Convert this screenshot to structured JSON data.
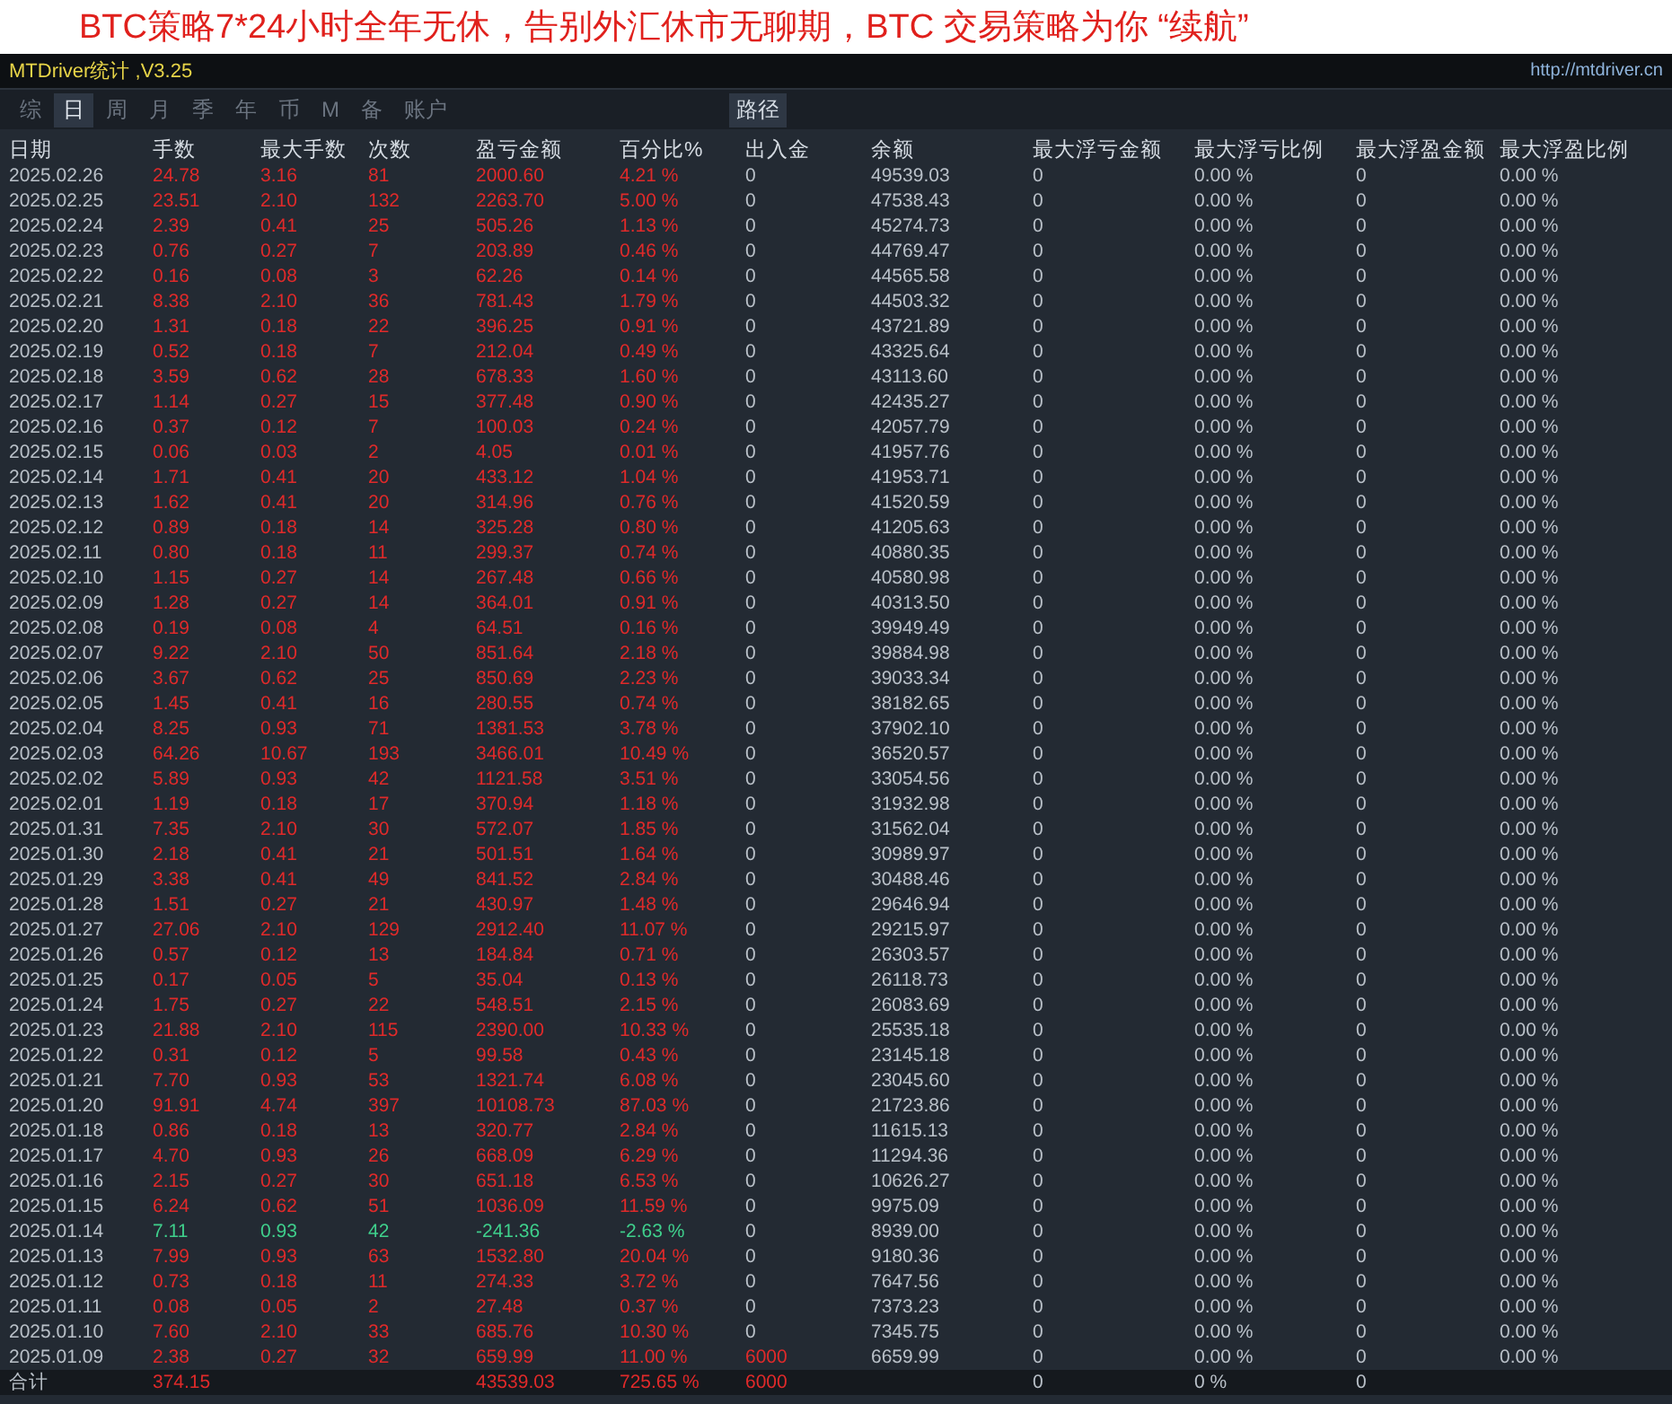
{
  "headline": "BTC策略7*24小时全年无休，告别外汇休市无聊期，BTC 交易策略为你 “续航”",
  "window": {
    "title": "MTDriver统计 ,V3.25",
    "url": "http://mtdriver.cn"
  },
  "tabs": [
    {
      "label": "综",
      "selected": false
    },
    {
      "label": "日",
      "selected": true
    },
    {
      "label": "周",
      "selected": false
    },
    {
      "label": "月",
      "selected": false
    },
    {
      "label": "季",
      "selected": false
    },
    {
      "label": "年",
      "selected": false
    },
    {
      "label": "币",
      "selected": false
    },
    {
      "label": "M",
      "selected": false
    },
    {
      "label": "备",
      "selected": false
    },
    {
      "label": "账户",
      "selected": false
    }
  ],
  "path_button": "路径",
  "columns": [
    "日期",
    "手数",
    "最大手数",
    "次数",
    "盈亏金额",
    "百分比%",
    "出入金",
    "余额",
    "最大浮亏金额",
    "最大浮亏比例",
    "最大浮盈金额",
    "最大浮盈比例"
  ],
  "rows": [
    {
      "cells": [
        "2025.02.26",
        "24.78",
        "3.16",
        "81",
        "2000.60",
        "4.21 %",
        "0",
        "49539.03",
        "0",
        "0.00 %",
        "0",
        "0.00 %"
      ],
      "loss": false,
      "deposit": false
    },
    {
      "cells": [
        "2025.02.25",
        "23.51",
        "2.10",
        "132",
        "2263.70",
        "5.00 %",
        "0",
        "47538.43",
        "0",
        "0.00 %",
        "0",
        "0.00 %"
      ],
      "loss": false,
      "deposit": false
    },
    {
      "cells": [
        "2025.02.24",
        "2.39",
        "0.41",
        "25",
        "505.26",
        "1.13 %",
        "0",
        "45274.73",
        "0",
        "0.00 %",
        "0",
        "0.00 %"
      ],
      "loss": false,
      "deposit": false
    },
    {
      "cells": [
        "2025.02.23",
        "0.76",
        "0.27",
        "7",
        "203.89",
        "0.46 %",
        "0",
        "44769.47",
        "0",
        "0.00 %",
        "0",
        "0.00 %"
      ],
      "loss": false,
      "deposit": false
    },
    {
      "cells": [
        "2025.02.22",
        "0.16",
        "0.08",
        "3",
        "62.26",
        "0.14 %",
        "0",
        "44565.58",
        "0",
        "0.00 %",
        "0",
        "0.00 %"
      ],
      "loss": false,
      "deposit": false
    },
    {
      "cells": [
        "2025.02.21",
        "8.38",
        "2.10",
        "36",
        "781.43",
        "1.79 %",
        "0",
        "44503.32",
        "0",
        "0.00 %",
        "0",
        "0.00 %"
      ],
      "loss": false,
      "deposit": false
    },
    {
      "cells": [
        "2025.02.20",
        "1.31",
        "0.18",
        "22",
        "396.25",
        "0.91 %",
        "0",
        "43721.89",
        "0",
        "0.00 %",
        "0",
        "0.00 %"
      ],
      "loss": false,
      "deposit": false
    },
    {
      "cells": [
        "2025.02.19",
        "0.52",
        "0.18",
        "7",
        "212.04",
        "0.49 %",
        "0",
        "43325.64",
        "0",
        "0.00 %",
        "0",
        "0.00 %"
      ],
      "loss": false,
      "deposit": false
    },
    {
      "cells": [
        "2025.02.18",
        "3.59",
        "0.62",
        "28",
        "678.33",
        "1.60 %",
        "0",
        "43113.60",
        "0",
        "0.00 %",
        "0",
        "0.00 %"
      ],
      "loss": false,
      "deposit": false
    },
    {
      "cells": [
        "2025.02.17",
        "1.14",
        "0.27",
        "15",
        "377.48",
        "0.90 %",
        "0",
        "42435.27",
        "0",
        "0.00 %",
        "0",
        "0.00 %"
      ],
      "loss": false,
      "deposit": false
    },
    {
      "cells": [
        "2025.02.16",
        "0.37",
        "0.12",
        "7",
        "100.03",
        "0.24 %",
        "0",
        "42057.79",
        "0",
        "0.00 %",
        "0",
        "0.00 %"
      ],
      "loss": false,
      "deposit": false
    },
    {
      "cells": [
        "2025.02.15",
        "0.06",
        "0.03",
        "2",
        "4.05",
        "0.01 %",
        "0",
        "41957.76",
        "0",
        "0.00 %",
        "0",
        "0.00 %"
      ],
      "loss": false,
      "deposit": false
    },
    {
      "cells": [
        "2025.02.14",
        "1.71",
        "0.41",
        "20",
        "433.12",
        "1.04 %",
        "0",
        "41953.71",
        "0",
        "0.00 %",
        "0",
        "0.00 %"
      ],
      "loss": false,
      "deposit": false
    },
    {
      "cells": [
        "2025.02.13",
        "1.62",
        "0.41",
        "20",
        "314.96",
        "0.76 %",
        "0",
        "41520.59",
        "0",
        "0.00 %",
        "0",
        "0.00 %"
      ],
      "loss": false,
      "deposit": false
    },
    {
      "cells": [
        "2025.02.12",
        "0.89",
        "0.18",
        "14",
        "325.28",
        "0.80 %",
        "0",
        "41205.63",
        "0",
        "0.00 %",
        "0",
        "0.00 %"
      ],
      "loss": false,
      "deposit": false
    },
    {
      "cells": [
        "2025.02.11",
        "0.80",
        "0.18",
        "11",
        "299.37",
        "0.74 %",
        "0",
        "40880.35",
        "0",
        "0.00 %",
        "0",
        "0.00 %"
      ],
      "loss": false,
      "deposit": false
    },
    {
      "cells": [
        "2025.02.10",
        "1.15",
        "0.27",
        "14",
        "267.48",
        "0.66 %",
        "0",
        "40580.98",
        "0",
        "0.00 %",
        "0",
        "0.00 %"
      ],
      "loss": false,
      "deposit": false
    },
    {
      "cells": [
        "2025.02.09",
        "1.28",
        "0.27",
        "14",
        "364.01",
        "0.91 %",
        "0",
        "40313.50",
        "0",
        "0.00 %",
        "0",
        "0.00 %"
      ],
      "loss": false,
      "deposit": false
    },
    {
      "cells": [
        "2025.02.08",
        "0.19",
        "0.08",
        "4",
        "64.51",
        "0.16 %",
        "0",
        "39949.49",
        "0",
        "0.00 %",
        "0",
        "0.00 %"
      ],
      "loss": false,
      "deposit": false
    },
    {
      "cells": [
        "2025.02.07",
        "9.22",
        "2.10",
        "50",
        "851.64",
        "2.18 %",
        "0",
        "39884.98",
        "0",
        "0.00 %",
        "0",
        "0.00 %"
      ],
      "loss": false,
      "deposit": false
    },
    {
      "cells": [
        "2025.02.06",
        "3.67",
        "0.62",
        "25",
        "850.69",
        "2.23 %",
        "0",
        "39033.34",
        "0",
        "0.00 %",
        "0",
        "0.00 %"
      ],
      "loss": false,
      "deposit": false
    },
    {
      "cells": [
        "2025.02.05",
        "1.45",
        "0.41",
        "16",
        "280.55",
        "0.74 %",
        "0",
        "38182.65",
        "0",
        "0.00 %",
        "0",
        "0.00 %"
      ],
      "loss": false,
      "deposit": false
    },
    {
      "cells": [
        "2025.02.04",
        "8.25",
        "0.93",
        "71",
        "1381.53",
        "3.78 %",
        "0",
        "37902.10",
        "0",
        "0.00 %",
        "0",
        "0.00 %"
      ],
      "loss": false,
      "deposit": false
    },
    {
      "cells": [
        "2025.02.03",
        "64.26",
        "10.67",
        "193",
        "3466.01",
        "10.49 %",
        "0",
        "36520.57",
        "0",
        "0.00 %",
        "0",
        "0.00 %"
      ],
      "loss": false,
      "deposit": false
    },
    {
      "cells": [
        "2025.02.02",
        "5.89",
        "0.93",
        "42",
        "1121.58",
        "3.51 %",
        "0",
        "33054.56",
        "0",
        "0.00 %",
        "0",
        "0.00 %"
      ],
      "loss": false,
      "deposit": false
    },
    {
      "cells": [
        "2025.02.01",
        "1.19",
        "0.18",
        "17",
        "370.94",
        "1.18 %",
        "0",
        "31932.98",
        "0",
        "0.00 %",
        "0",
        "0.00 %"
      ],
      "loss": false,
      "deposit": false
    },
    {
      "cells": [
        "2025.01.31",
        "7.35",
        "2.10",
        "30",
        "572.07",
        "1.85 %",
        "0",
        "31562.04",
        "0",
        "0.00 %",
        "0",
        "0.00 %"
      ],
      "loss": false,
      "deposit": false
    },
    {
      "cells": [
        "2025.01.30",
        "2.18",
        "0.41",
        "21",
        "501.51",
        "1.64 %",
        "0",
        "30989.97",
        "0",
        "0.00 %",
        "0",
        "0.00 %"
      ],
      "loss": false,
      "deposit": false
    },
    {
      "cells": [
        "2025.01.29",
        "3.38",
        "0.41",
        "49",
        "841.52",
        "2.84 %",
        "0",
        "30488.46",
        "0",
        "0.00 %",
        "0",
        "0.00 %"
      ],
      "loss": false,
      "deposit": false
    },
    {
      "cells": [
        "2025.01.28",
        "1.51",
        "0.27",
        "21",
        "430.97",
        "1.48 %",
        "0",
        "29646.94",
        "0",
        "0.00 %",
        "0",
        "0.00 %"
      ],
      "loss": false,
      "deposit": false
    },
    {
      "cells": [
        "2025.01.27",
        "27.06",
        "2.10",
        "129",
        "2912.40",
        "11.07 %",
        "0",
        "29215.97",
        "0",
        "0.00 %",
        "0",
        "0.00 %"
      ],
      "loss": false,
      "deposit": false
    },
    {
      "cells": [
        "2025.01.26",
        "0.57",
        "0.12",
        "13",
        "184.84",
        "0.71 %",
        "0",
        "26303.57",
        "0",
        "0.00 %",
        "0",
        "0.00 %"
      ],
      "loss": false,
      "deposit": false
    },
    {
      "cells": [
        "2025.01.25",
        "0.17",
        "0.05",
        "5",
        "35.04",
        "0.13 %",
        "0",
        "26118.73",
        "0",
        "0.00 %",
        "0",
        "0.00 %"
      ],
      "loss": false,
      "deposit": false
    },
    {
      "cells": [
        "2025.01.24",
        "1.75",
        "0.27",
        "22",
        "548.51",
        "2.15 %",
        "0",
        "26083.69",
        "0",
        "0.00 %",
        "0",
        "0.00 %"
      ],
      "loss": false,
      "deposit": false
    },
    {
      "cells": [
        "2025.01.23",
        "21.88",
        "2.10",
        "115",
        "2390.00",
        "10.33 %",
        "0",
        "25535.18",
        "0",
        "0.00 %",
        "0",
        "0.00 %"
      ],
      "loss": false,
      "deposit": false
    },
    {
      "cells": [
        "2025.01.22",
        "0.31",
        "0.12",
        "5",
        "99.58",
        "0.43 %",
        "0",
        "23145.18",
        "0",
        "0.00 %",
        "0",
        "0.00 %"
      ],
      "loss": false,
      "deposit": false
    },
    {
      "cells": [
        "2025.01.21",
        "7.70",
        "0.93",
        "53",
        "1321.74",
        "6.08 %",
        "0",
        "23045.60",
        "0",
        "0.00 %",
        "0",
        "0.00 %"
      ],
      "loss": false,
      "deposit": false
    },
    {
      "cells": [
        "2025.01.20",
        "91.91",
        "4.74",
        "397",
        "10108.73",
        "87.03 %",
        "0",
        "21723.86",
        "0",
        "0.00 %",
        "0",
        "0.00 %"
      ],
      "loss": false,
      "deposit": false
    },
    {
      "cells": [
        "2025.01.18",
        "0.86",
        "0.18",
        "13",
        "320.77",
        "2.84 %",
        "0",
        "11615.13",
        "0",
        "0.00 %",
        "0",
        "0.00 %"
      ],
      "loss": false,
      "deposit": false
    },
    {
      "cells": [
        "2025.01.17",
        "4.70",
        "0.93",
        "26",
        "668.09",
        "6.29 %",
        "0",
        "11294.36",
        "0",
        "0.00 %",
        "0",
        "0.00 %"
      ],
      "loss": false,
      "deposit": false
    },
    {
      "cells": [
        "2025.01.16",
        "2.15",
        "0.27",
        "30",
        "651.18",
        "6.53 %",
        "0",
        "10626.27",
        "0",
        "0.00 %",
        "0",
        "0.00 %"
      ],
      "loss": false,
      "deposit": false
    },
    {
      "cells": [
        "2025.01.15",
        "6.24",
        "0.62",
        "51",
        "1036.09",
        "11.59 %",
        "0",
        "9975.09",
        "0",
        "0.00 %",
        "0",
        "0.00 %"
      ],
      "loss": false,
      "deposit": false
    },
    {
      "cells": [
        "2025.01.14",
        "7.11",
        "0.93",
        "42",
        "-241.36",
        "-2.63 %",
        "0",
        "8939.00",
        "0",
        "0.00 %",
        "0",
        "0.00 %"
      ],
      "loss": true,
      "deposit": false
    },
    {
      "cells": [
        "2025.01.13",
        "7.99",
        "0.93",
        "63",
        "1532.80",
        "20.04 %",
        "0",
        "9180.36",
        "0",
        "0.00 %",
        "0",
        "0.00 %"
      ],
      "loss": false,
      "deposit": false
    },
    {
      "cells": [
        "2025.01.12",
        "0.73",
        "0.18",
        "11",
        "274.33",
        "3.72 %",
        "0",
        "7647.56",
        "0",
        "0.00 %",
        "0",
        "0.00 %"
      ],
      "loss": false,
      "deposit": false
    },
    {
      "cells": [
        "2025.01.11",
        "0.08",
        "0.05",
        "2",
        "27.48",
        "0.37 %",
        "0",
        "7373.23",
        "0",
        "0.00 %",
        "0",
        "0.00 %"
      ],
      "loss": false,
      "deposit": false
    },
    {
      "cells": [
        "2025.01.10",
        "7.60",
        "2.10",
        "33",
        "685.76",
        "10.30 %",
        "0",
        "7345.75",
        "0",
        "0.00 %",
        "0",
        "0.00 %"
      ],
      "loss": false,
      "deposit": false
    },
    {
      "cells": [
        "2025.01.09",
        "2.38",
        "0.27",
        "32",
        "659.99",
        "11.00 %",
        "6000",
        "6659.99",
        "0",
        "0.00 %",
        "0",
        "0.00 %"
      ],
      "loss": false,
      "deposit": true
    }
  ],
  "total": {
    "label": "合计",
    "lots": "374.15",
    "pnl": "43539.03",
    "pct": "725.65 %",
    "flow": "6000",
    "max_float_loss": "0",
    "max_float_loss_pct": "0 %",
    "max_float_profit": "0"
  }
}
